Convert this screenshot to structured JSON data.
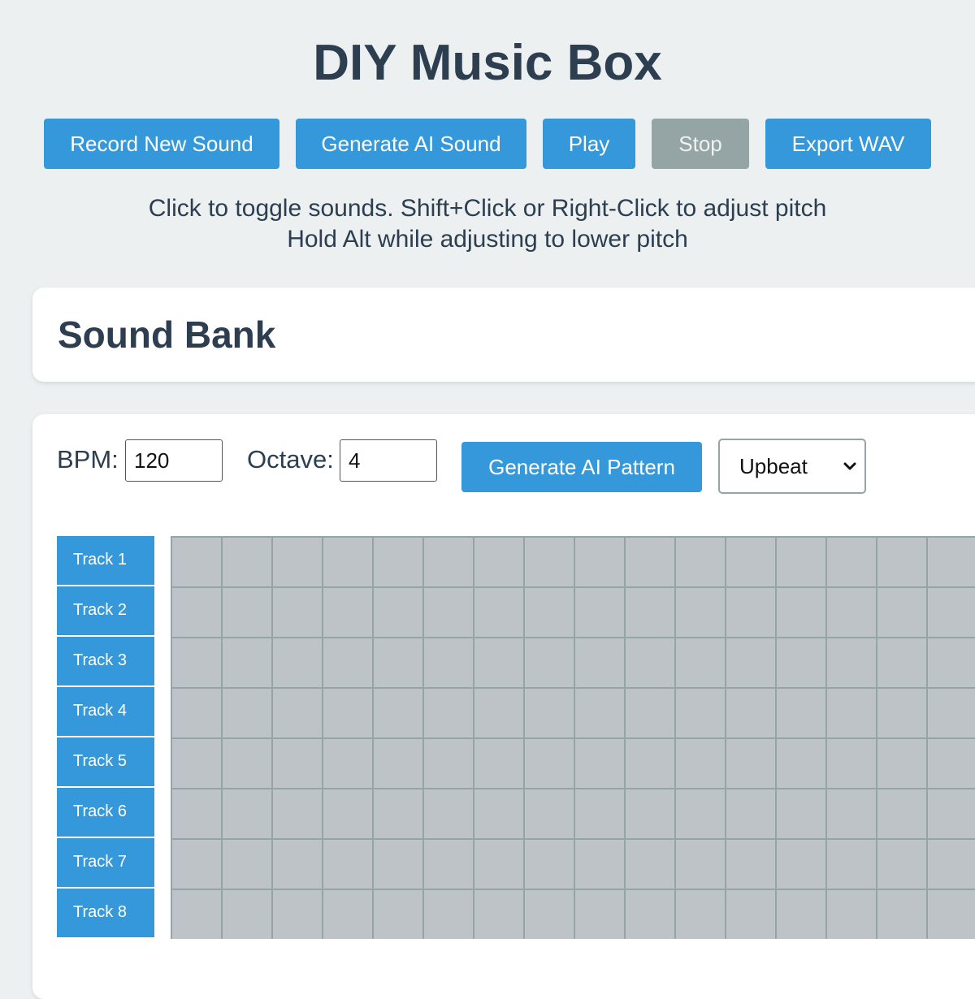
{
  "app": {
    "title": "DIY Music Box"
  },
  "toolbar": {
    "record_label": "Record New Sound",
    "generate_sound_label": "Generate AI Sound",
    "play_label": "Play",
    "stop_label": "Stop",
    "export_label": "Export WAV"
  },
  "instructions": {
    "line1": "Click to toggle sounds. Shift+Click or Right-Click to adjust pitch",
    "line2": "Hold Alt while adjusting to lower pitch"
  },
  "sound_bank": {
    "title": "Sound Bank"
  },
  "sequencer": {
    "bpm_label": "BPM:",
    "bpm_value": "120",
    "octave_label": "Octave:",
    "octave_value": "4",
    "generate_pattern_label": "Generate AI Pattern",
    "style_selected": "Upbeat",
    "tracks": [
      "Track 1",
      "Track 2",
      "Track 3",
      "Track 4",
      "Track 5",
      "Track 6",
      "Track 7",
      "Track 8"
    ],
    "steps_visible": 16
  },
  "colors": {
    "accent": "#3498db",
    "disabled": "#95a5a6",
    "background": "#ecf0f1",
    "text": "#2c3e50",
    "cell_off": "#bdc3c7"
  },
  "icons": {
    "select_arrow": "chevron-down-icon"
  }
}
